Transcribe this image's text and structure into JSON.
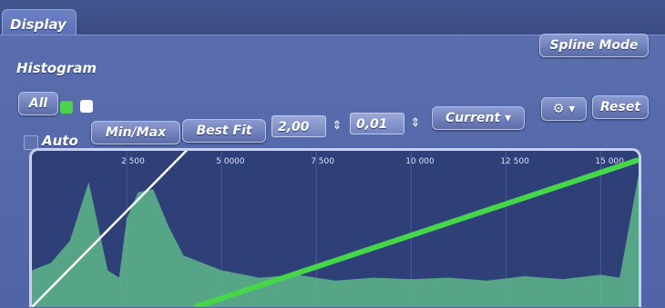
{
  "tab": {
    "label": "Display"
  },
  "histogram": {
    "title": "Histogram",
    "channel_label": "All",
    "auto_label": "Auto",
    "auto_checked": false,
    "min_max_label": "Min/Max",
    "best_fit_label": "Best Fit",
    "gamma_value": "2,00",
    "step_value": "0,01",
    "mode_value": "Current",
    "settings_icon": "gear-icon",
    "reset_label": "Reset",
    "spline_mode_label": "Spline Mode"
  },
  "colors": {
    "panel": "#5064a6",
    "channel_green": "#4cd44c",
    "channel_white": "#ffffff",
    "histogram_fill": "#5fbf8a",
    "curve_green": "#46d64a",
    "curve_white": "#ffffff"
  },
  "chart_data": {
    "type": "area",
    "x_tick_labels": [
      "2 500",
      "5 0000",
      "7 500",
      "10 000",
      "12 500",
      "15 000"
    ],
    "x_tick_values": [
      2500,
      5000,
      7500,
      10000,
      12500,
      15000
    ],
    "xlim": [
      0,
      16000
    ],
    "ylim": [
      0,
      1
    ],
    "series": [
      {
        "x": [
          0,
          500,
          1000,
          1500,
          2000,
          2300,
          2500,
          2800,
          3200,
          3600,
          4000,
          4500,
          5000,
          6000,
          7000,
          8000,
          9000,
          10000,
          11000,
          12000,
          13000,
          14000,
          15000,
          15500,
          16000
        ],
        "y": [
          0.25,
          0.3,
          0.45,
          0.85,
          0.25,
          0.2,
          0.6,
          0.78,
          0.8,
          0.55,
          0.35,
          0.3,
          0.25,
          0.2,
          0.22,
          0.18,
          0.2,
          0.19,
          0.2,
          0.18,
          0.21,
          0.19,
          0.22,
          0.2,
          0.9
        ]
      }
    ],
    "curves": [
      {
        "x": [
          0,
          4600
        ],
        "y": [
          0,
          1.2
        ]
      },
      {
        "x": [
          4300,
          16000
        ],
        "y": [
          0,
          1
        ]
      }
    ],
    "grid": true
  }
}
